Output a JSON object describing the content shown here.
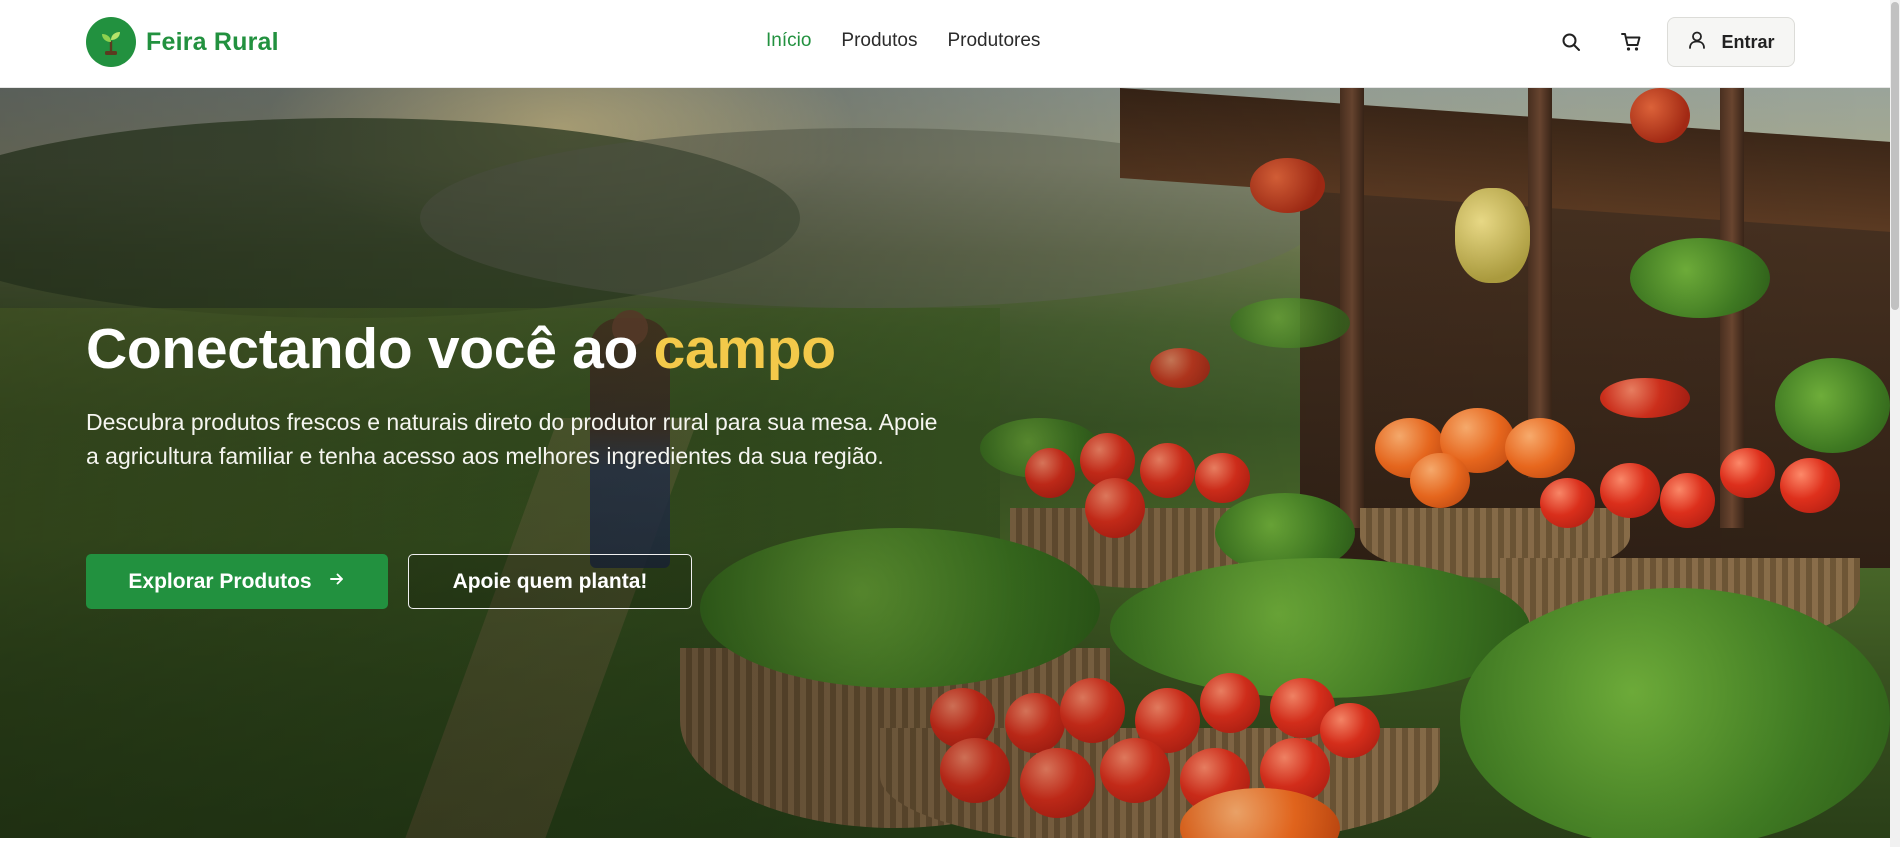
{
  "brand": {
    "name": "Feira Rural",
    "icon": "sprout-icon",
    "color": "#22913f"
  },
  "nav": {
    "items": [
      {
        "label": "Início",
        "active": true
      },
      {
        "label": "Produtos",
        "active": false
      },
      {
        "label": "Produtores",
        "active": false
      }
    ]
  },
  "actions": {
    "search_icon": "search-icon",
    "cart_icon": "cart-icon",
    "login_label": "Entrar",
    "login_icon": "user-icon"
  },
  "hero": {
    "title_main": "Conectando você ao ",
    "title_accent": "campo",
    "description": "Descubra produtos frescos e naturais direto do produtor rural para sua mesa. Apoie a agricultura familiar e tenha acesso aos melhores ingredientes da sua região.",
    "primary_button": "Explorar Produtos",
    "secondary_button": "Apoie quem planta!",
    "accent_color": "#f3c94a"
  }
}
